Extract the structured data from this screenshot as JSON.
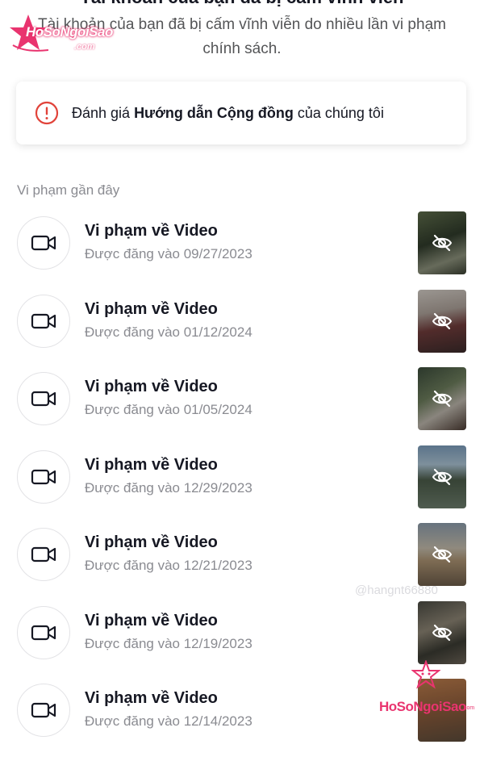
{
  "header": {
    "cutoff_title": "Tài khoản của bạn đã bị cấm vĩnh viễn",
    "ban_message": "Tài khoản của bạn đã bị cấm vĩnh viễn do nhiều lần vi phạm chính sách."
  },
  "guidelines_card": {
    "prefix": "Đánh giá ",
    "link": "Hướng dẫn Cộng đồng",
    "suffix": " của chúng tôi",
    "icon": "exclamation-circle-icon"
  },
  "violations": {
    "section_title": "Vi phạm gần đây",
    "items": [
      {
        "title": "Vi phạm về Video",
        "date": "Được đăng vào 09/27/2023"
      },
      {
        "title": "Vi phạm về Video",
        "date": "Được đăng vào 01/12/2024"
      },
      {
        "title": "Vi phạm về Video",
        "date": "Được đăng vào 01/05/2024"
      },
      {
        "title": "Vi phạm về Video",
        "date": "Được đăng vào 12/29/2023"
      },
      {
        "title": "Vi phạm về Video",
        "date": "Được đăng vào 12/21/2023"
      },
      {
        "title": "Vi phạm về Video",
        "date": "Được đăng vào 12/19/2023"
      },
      {
        "title": "Vi phạm về Video",
        "date": "Được đăng vào 12/14/2023"
      }
    ]
  },
  "watermarks": {
    "top_logo": "HoSoNgoiSao",
    "top_logo_domain": ".com",
    "bottom_logo": "HoSoNgoiSao",
    "bottom_logo_domain": ".com",
    "tiktok_handle": "@hangnt66880"
  },
  "colors": {
    "accent_red": "#e1433a",
    "brand_pink": "#e9346f",
    "text_primary": "#161823",
    "text_secondary": "#8a8b91"
  }
}
